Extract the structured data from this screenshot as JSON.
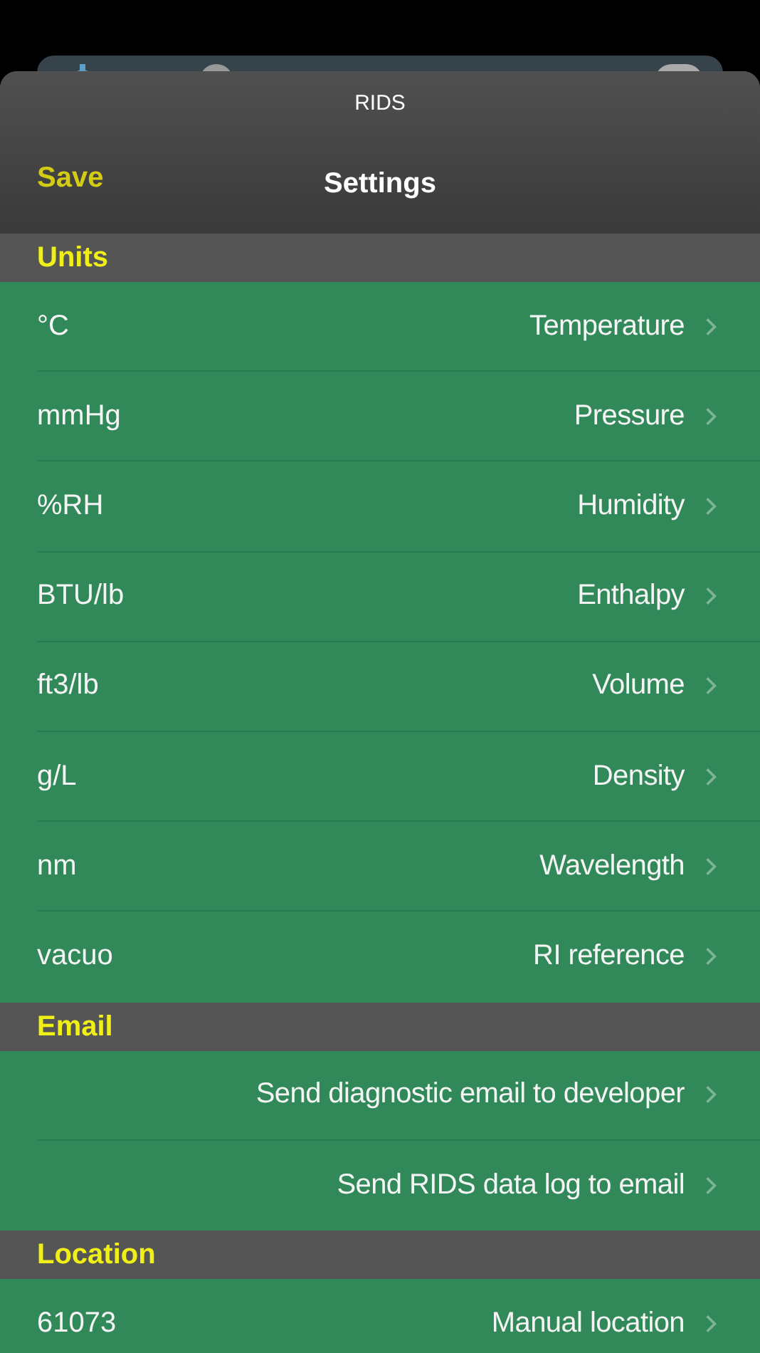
{
  "sheet": {
    "caption": "RIDS",
    "save": "Save",
    "title": "Settings"
  },
  "sections": [
    {
      "title": "Units",
      "rows": [
        {
          "value": "°C",
          "label": "Temperature"
        },
        {
          "value": "mmHg",
          "label": "Pressure"
        },
        {
          "value": "%RH",
          "label": "Humidity"
        },
        {
          "value": "BTU/lb",
          "label": "Enthalpy"
        },
        {
          "value": "ft3/lb",
          "label": "Volume"
        },
        {
          "value": "g/L",
          "label": "Density"
        },
        {
          "value": "nm",
          "label": "Wavelength"
        },
        {
          "value": "vacuo",
          "label": "RI reference"
        }
      ]
    },
    {
      "title": "Email",
      "rows": [
        {
          "label": "Send diagnostic email to developer"
        },
        {
          "label": "Send RIDS data log to email"
        }
      ]
    },
    {
      "title": "Location",
      "rows": [
        {
          "value": "61073",
          "label": "Manual location"
        }
      ]
    }
  ]
}
